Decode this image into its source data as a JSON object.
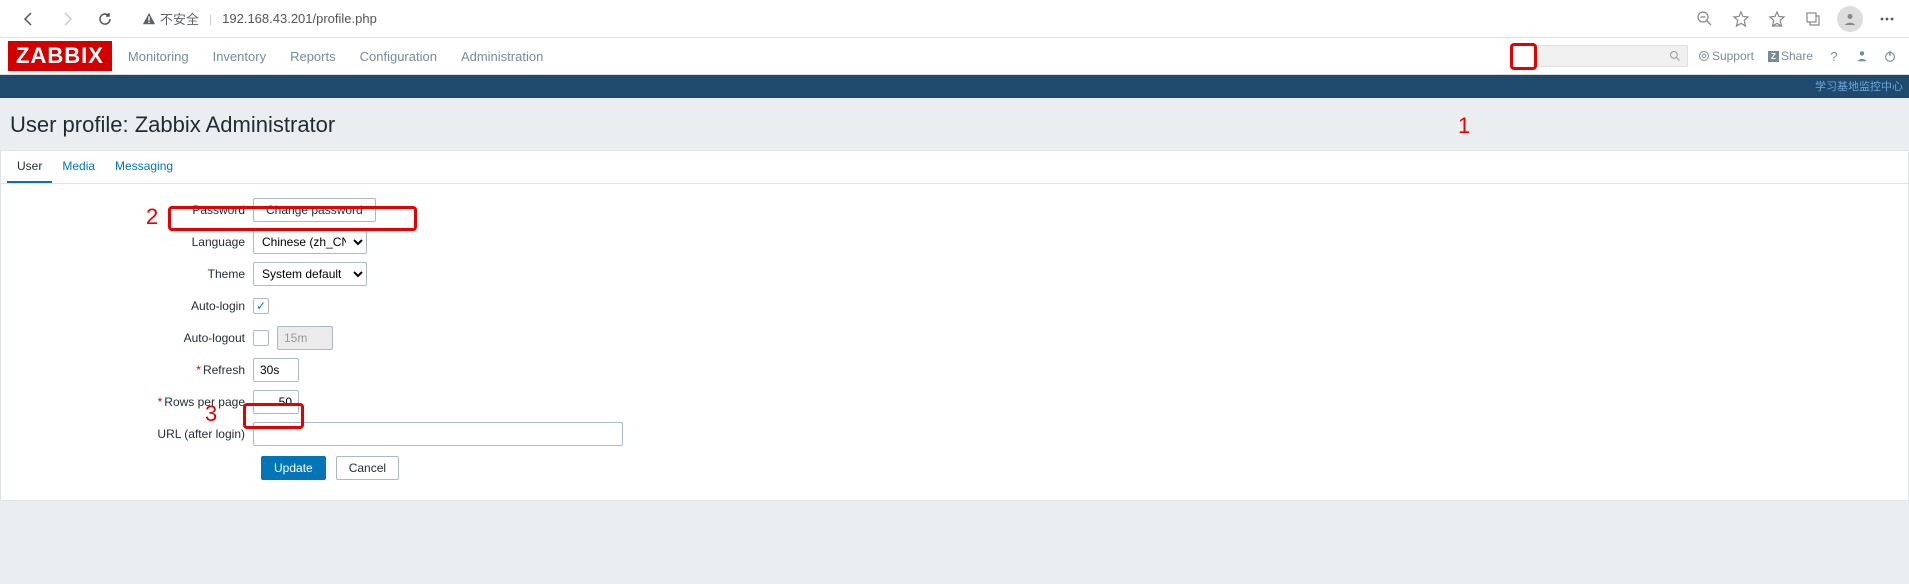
{
  "browser": {
    "insecure_label": "不安全",
    "url": "192.168.43.201/profile.php"
  },
  "logo": "ZABBIX",
  "topnav": {
    "items": [
      "Monitoring",
      "Inventory",
      "Reports",
      "Configuration",
      "Administration"
    ],
    "support": "Support",
    "share": "Share"
  },
  "subbar_right": "学习基地监控中心",
  "page_title": "User profile: Zabbix Administrator",
  "tabs": {
    "user": "User",
    "media": "Media",
    "messaging": "Messaging"
  },
  "form": {
    "password_label": "Password",
    "change_password": "Change password",
    "language_label": "Language",
    "language_value": "Chinese (zh_CN)",
    "theme_label": "Theme",
    "theme_value": "System default",
    "autologin_label": "Auto-login",
    "autologout_label": "Auto-logout",
    "autologout_value": "15m",
    "refresh_label": "Refresh",
    "refresh_value": "30s",
    "rows_label": "Rows per page",
    "rows_value": "50",
    "url_label": "URL (after login)",
    "url_value": "",
    "update": "Update",
    "cancel": "Cancel"
  },
  "annotations": {
    "n1": "1",
    "n2": "2",
    "n3": "3"
  }
}
